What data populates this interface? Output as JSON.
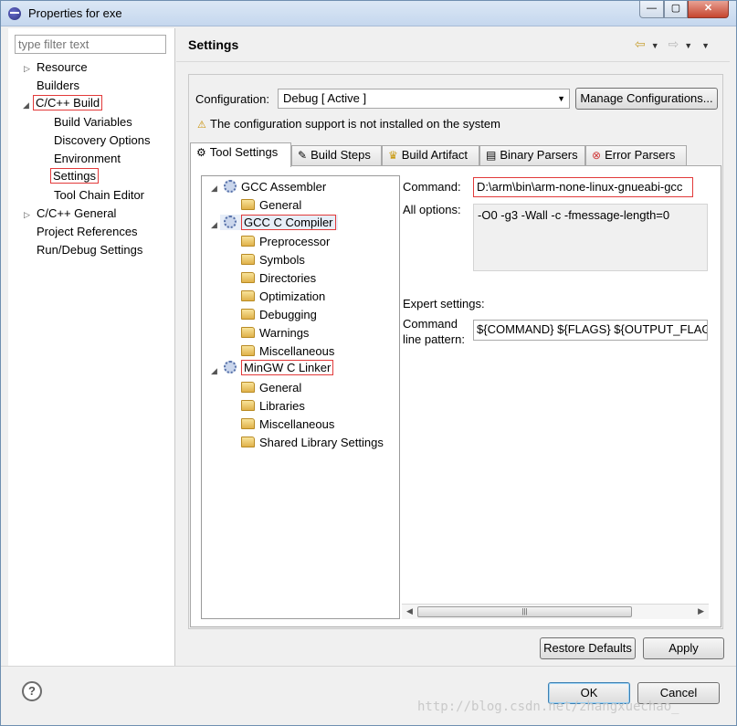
{
  "window": {
    "title": "Properties for exe"
  },
  "filter": {
    "placeholder": "type filter text"
  },
  "nav": {
    "resource": "Resource",
    "builders": "Builders",
    "cpp_build": "C/C++ Build",
    "build_variables": "Build Variables",
    "discovery_options": "Discovery Options",
    "environment": "Environment",
    "settings": "Settings",
    "tool_chain_editor": "Tool Chain Editor",
    "cpp_general": "C/C++ General",
    "project_references": "Project References",
    "run_debug_settings": "Run/Debug Settings"
  },
  "page": {
    "title": "Settings"
  },
  "config": {
    "label": "Configuration:",
    "value": "Debug  [ Active ]",
    "manage_button": "Manage Configurations...",
    "warning": "The configuration support is not installed on the system"
  },
  "tabs": [
    "Tool Settings",
    "Build Steps",
    "Build Artifact",
    "Binary Parsers",
    "Error Parsers"
  ],
  "tree": {
    "gcc_assembler": "GCC Assembler",
    "asm_general": "General",
    "gcc_c_compiler": "GCC C Compiler",
    "preprocessor": "Preprocessor",
    "symbols": "Symbols",
    "directories": "Directories",
    "optimization": "Optimization",
    "debugging": "Debugging",
    "warnings": "Warnings",
    "miscellaneous": "Miscellaneous",
    "mingw_linker": "MinGW C Linker",
    "linker_general": "General",
    "libraries": "Libraries",
    "linker_misc": "Miscellaneous",
    "shared_lib": "Shared Library Settings"
  },
  "details": {
    "command_label": "Command:",
    "command_value": "D:\\arm\\bin\\arm-none-linux-gnueabi-gcc",
    "all_options_label": "All options:",
    "all_options_value": "-O0 -g3 -Wall -c -fmessage-length=0",
    "expert_label": "Expert settings:",
    "pattern_label_1": "Command",
    "pattern_label_2": "line pattern:",
    "pattern_value": "${COMMAND} ${FLAGS} ${OUTPUT_FLAG}${OUTPUT_PREFIX}${OUTPUT} ${INPUTS}"
  },
  "buttons": {
    "restore_defaults": "Restore Defaults",
    "apply": "Apply",
    "ok": "OK",
    "cancel": "Cancel",
    "help": "?"
  },
  "watermark": "http://blog.csdn.net/zhangxuechao_"
}
